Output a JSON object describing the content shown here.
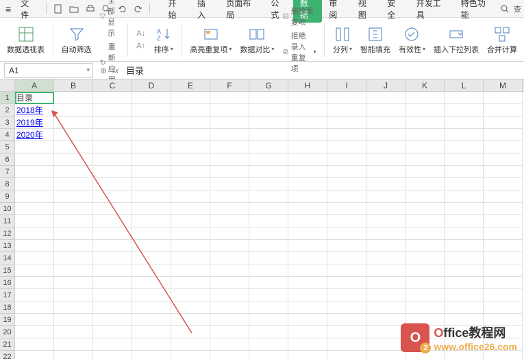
{
  "menubar": {
    "file_label": "文件",
    "tabs": [
      "开始",
      "插入",
      "页面布局",
      "公式",
      "数据",
      "审阅",
      "视图",
      "安全",
      "开发工具",
      "特色功能"
    ],
    "active_tab_index": 4,
    "search_label": "查"
  },
  "ribbon": {
    "pivot_table": "数据透视表",
    "auto_filter": "自动筛选",
    "show_all": "全部显示",
    "reapply": "重新应用",
    "sort": "排序",
    "highlight_dup": "高亮重复项",
    "data_compare": "数据对比",
    "remove_dup": "删除重复项",
    "reject_dup": "拒绝录入重复项",
    "text_to_col": "分列",
    "flash_fill": "智能填充",
    "validation": "有效性",
    "dropdown_insert": "插入下拉列表",
    "consolidate": "合并计算"
  },
  "formula_bar": {
    "cell_ref": "A1",
    "content": "目录"
  },
  "grid": {
    "columns": [
      "A",
      "B",
      "C",
      "D",
      "E",
      "F",
      "G",
      "H",
      "I",
      "J",
      "K",
      "L",
      "M"
    ],
    "row_count": 22,
    "active_cell": {
      "row": 1,
      "col": "A"
    },
    "cells": {
      "A1": {
        "value": "目录",
        "link": false
      },
      "A2": {
        "value": "2018年",
        "link": true
      },
      "A3": {
        "value": "2019年",
        "link": true
      },
      "A4": {
        "value": "2020年",
        "link": true
      }
    }
  },
  "watermark": {
    "title_part1": "O",
    "title_part2": "ffice教程网",
    "url": "www.office26.com",
    "logo_letter": "O"
  }
}
